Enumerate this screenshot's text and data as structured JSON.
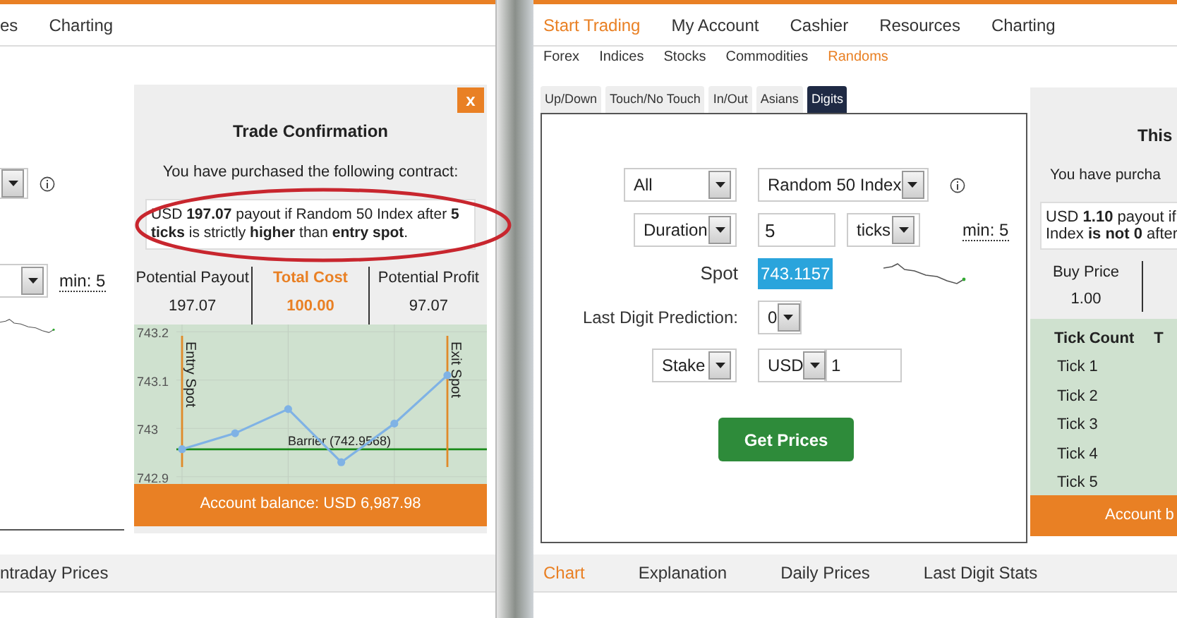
{
  "left_window": {
    "nav": [
      {
        "label": "es",
        "selected": false
      },
      {
        "label": "Charting",
        "selected": false
      }
    ],
    "form_fragment": {
      "min_hint": "min: 5"
    },
    "confirmation": {
      "close": "x",
      "title": "Trade Confirmation",
      "subtitle": "You have purchased the following contract:",
      "contract": {
        "text": "USD **197.07** payout if Random 50 Index after **5 ticks** is strictly **higher** than **entry spot**.",
        "highlighted": true
      },
      "summary": [
        {
          "label": "Potential Payout",
          "value": "197.07",
          "selected": false
        },
        {
          "label": "Total Cost",
          "value": "100.00",
          "selected": true
        },
        {
          "label": "Potential Profit",
          "value": "97.07",
          "selected": false
        }
      ],
      "chart_data": {
        "type": "line",
        "grid": true,
        "series": [
          {
            "color": "#7fb2e5",
            "marker": true,
            "values": [
              742.957,
              742.99,
              743.04,
              742.93,
              743.01,
              743.11
            ]
          }
        ],
        "ylim": [
          742.885,
          743.215
        ],
        "yticks": [
          {
            "value": 743.2,
            "label": "743.2"
          },
          {
            "value": 743.1,
            "label": "743.1"
          },
          {
            "value": 743,
            "label": "743"
          },
          {
            "value": 742.9,
            "label": "742.9"
          }
        ],
        "ref_lines": [
          {
            "axis": "y",
            "value": 742.9568,
            "label": "Barrier (742.9568)",
            "color": "#1a8a1a"
          }
        ],
        "annotations": [
          {
            "text": "Entry Spot"
          },
          {
            "text": "Exit Spot"
          }
        ]
      },
      "balance": "Account balance: USD 6,987.98"
    },
    "bottom_tabs": [
      {
        "label": "ntraday Prices",
        "selected": false
      }
    ]
  },
  "right_window": {
    "nav": [
      {
        "label": "Start Trading",
        "selected": true
      },
      {
        "label": "My Account",
        "selected": false
      },
      {
        "label": "Cashier",
        "selected": false
      },
      {
        "label": "Resources",
        "selected": false
      },
      {
        "label": "Charting",
        "selected": false
      }
    ],
    "submenu": [
      {
        "label": "Forex",
        "selected": false
      },
      {
        "label": "Indices",
        "selected": false
      },
      {
        "label": "Stocks",
        "selected": false
      },
      {
        "label": "Commodities",
        "selected": false
      },
      {
        "label": "Randoms",
        "selected": true
      }
    ],
    "contract_tabs": [
      {
        "label": "Up/Down",
        "selected": false
      },
      {
        "label": "Touch/No Touch",
        "selected": false
      },
      {
        "label": "In/Out",
        "selected": false
      },
      {
        "label": "Asians",
        "selected": false
      },
      {
        "label": "Digits",
        "selected": true
      }
    ],
    "form": {
      "market": "All",
      "symbol": "Random 50 Index",
      "duration_type": "Duration",
      "duration_value": "5",
      "duration_unit": "ticks",
      "min_hint": "min: 5",
      "spot_label": "Spot",
      "spot_value": "743.1157",
      "prediction_label": "Last Digit Prediction:",
      "prediction_value": "0",
      "amount_type": "Stake",
      "currency": "USD",
      "amount": "1",
      "submit": "Get Prices"
    },
    "confirmation": {
      "title": "This",
      "subtitle": "You have purcha",
      "contract_lines": [
        "USD **1.10** payout if",
        "Index **is not 0** after"
      ],
      "summary": [
        {
          "label": "Buy Price",
          "value": "1.00"
        }
      ],
      "ticks_table": {
        "columns": [
          "Tick Count",
          "T"
        ],
        "rows": [
          "Tick 1",
          "Tick 2",
          "Tick 3",
          "Tick 4",
          "Tick 5"
        ]
      },
      "balance": "Account b"
    },
    "bottom_tabs": [
      {
        "label": "Chart",
        "selected": true
      },
      {
        "label": "Explanation",
        "selected": false
      },
      {
        "label": "Daily Prices",
        "selected": false
      },
      {
        "label": "Last Digit Stats",
        "selected": false
      }
    ]
  }
}
